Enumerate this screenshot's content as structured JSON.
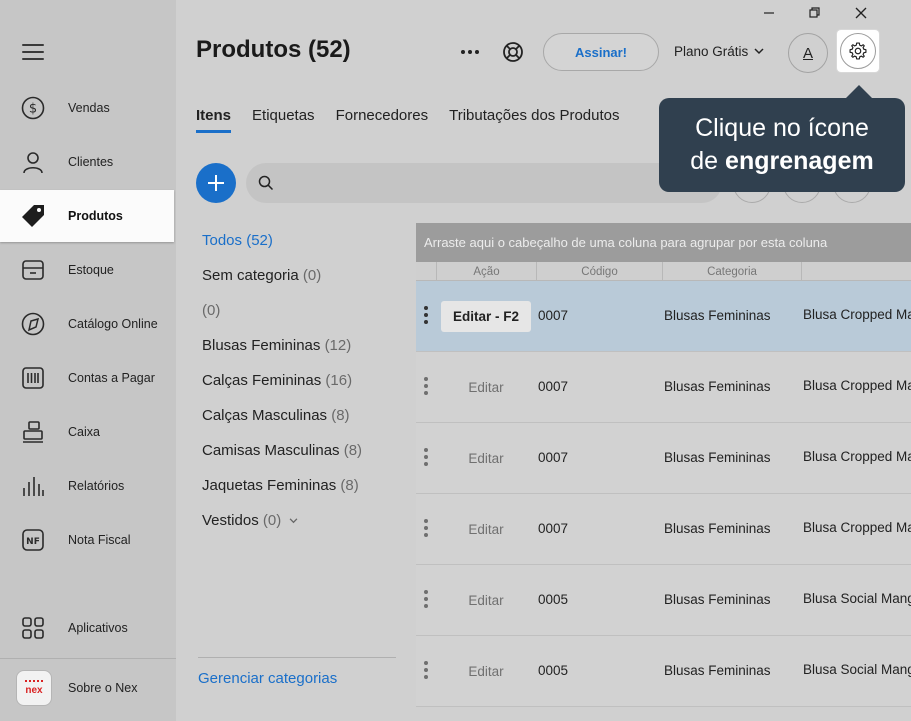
{
  "sidebar": {
    "items": [
      {
        "label": "Vendas",
        "icon": "dollar-circle-icon"
      },
      {
        "label": "Clientes",
        "icon": "person-icon"
      },
      {
        "label": "Produtos",
        "icon": "tag-icon",
        "active": true
      },
      {
        "label": "Estoque",
        "icon": "box-icon"
      },
      {
        "label": "Catálogo Online",
        "icon": "catalog-icon"
      },
      {
        "label": "Contas a Pagar",
        "icon": "barcode-icon"
      },
      {
        "label": "Caixa",
        "icon": "cash-register-icon"
      },
      {
        "label": "Relatórios",
        "icon": "bars-icon"
      },
      {
        "label": "Nota Fiscal",
        "icon": "nf-icon"
      }
    ],
    "apps_label": "Aplicativos",
    "about_label": "Sobre o Nex",
    "logo_text": "nex"
  },
  "header": {
    "title": "Produtos (52)",
    "subscribe_label": "Assinar!",
    "plan_label": "Plano Grátis",
    "avatar_letter": "A"
  },
  "tabs": [
    "Itens",
    "Etiquetas",
    "Fornecedores",
    "Tributações dos Produtos"
  ],
  "tooltip": {
    "line1": "Clique no ícone",
    "line2_prefix": "de ",
    "line2_bold": "engrenagem"
  },
  "search": {
    "placeholder": "",
    "value": ""
  },
  "categories": [
    {
      "name": "Todos",
      "count": "(52)",
      "active": true
    },
    {
      "name": "Sem categoria",
      "count": "(0)"
    },
    {
      "name": "",
      "count": "(0)"
    },
    {
      "name": "Blusas Femininas",
      "count": "(12)"
    },
    {
      "name": "Calças Femininas",
      "count": "(16)"
    },
    {
      "name": "Calças Masculinas",
      "count": "(8)"
    },
    {
      "name": "Camisas Masculinas",
      "count": "(8)"
    },
    {
      "name": "Jaquetas Femininas",
      "count": "(8)"
    },
    {
      "name": "Vestidos",
      "count": "(0)"
    }
  ],
  "manage_categories_label": "Gerenciar categorias",
  "grid": {
    "group_hint": "Arraste aqui o cabeçalho de uma coluna para agrupar por esta coluna",
    "columns": [
      "Ação",
      "Código",
      "Categoria"
    ],
    "rows": [
      {
        "action": "Editar - F2",
        "code": "0007",
        "category": "Blusas Femininas",
        "description": "Blusa Cropped Ma",
        "selected": true
      },
      {
        "action": "Editar",
        "code": "0007",
        "category": "Blusas Femininas",
        "description": "Blusa Cropped Ma"
      },
      {
        "action": "Editar",
        "code": "0007",
        "category": "Blusas Femininas",
        "description": "Blusa Cropped Ma"
      },
      {
        "action": "Editar",
        "code": "0007",
        "category": "Blusas Femininas",
        "description": "Blusa Cropped Ma"
      },
      {
        "action": "Editar",
        "code": "0005",
        "category": "Blusas Femininas",
        "description": "Blusa Social Mang"
      },
      {
        "action": "Editar",
        "code": "0005",
        "category": "Blusas Femininas",
        "description": "Blusa Social Mang"
      }
    ]
  },
  "colors": {
    "accent": "#1a6fc9",
    "tooltip_bg": "#30404f"
  }
}
